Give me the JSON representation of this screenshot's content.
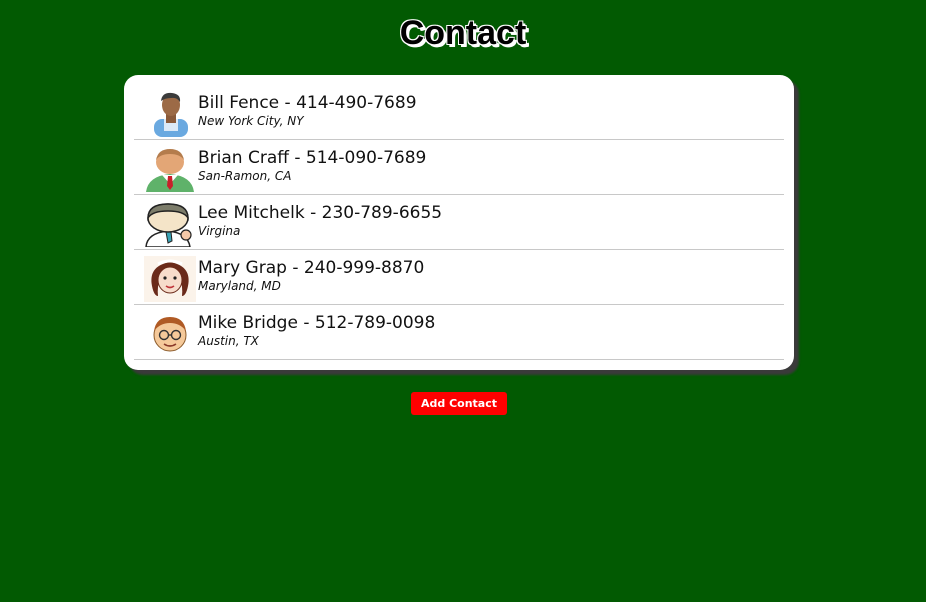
{
  "page": {
    "title": "Contact"
  },
  "colors": {
    "background": "#025a02",
    "card": "#ffffff",
    "button": "#ff0000",
    "button_text": "#ffffff"
  },
  "contacts": [
    {
      "name": "Bill Fence",
      "phone": "414-490-7689",
      "separator": " - ",
      "location": "New York City, NY",
      "avatar_icon": "businessman-avatar-icon"
    },
    {
      "name": "Brian Craff",
      "phone": "514-090-7689",
      "separator": " - ",
      "location": "San-Ramon, CA",
      "avatar_icon": "man-with-tie-avatar-icon"
    },
    {
      "name": "Lee Mitchelk",
      "phone": "230-789-6655",
      "separator": " - ",
      "location": "Virgina",
      "avatar_icon": "cartoon-man-thumbs-up-avatar-icon"
    },
    {
      "name": "Mary Grap",
      "phone": "240-999-8870",
      "separator": " - ",
      "location": "Maryland, MD",
      "avatar_icon": "woman-avatar-icon"
    },
    {
      "name": "Mike Bridge",
      "phone": "512-789-0098",
      "separator": " - ",
      "location": "Austin, TX",
      "avatar_icon": "man-with-glasses-avatar-icon"
    }
  ],
  "actions": {
    "add_contact_label": "Add Contact"
  }
}
